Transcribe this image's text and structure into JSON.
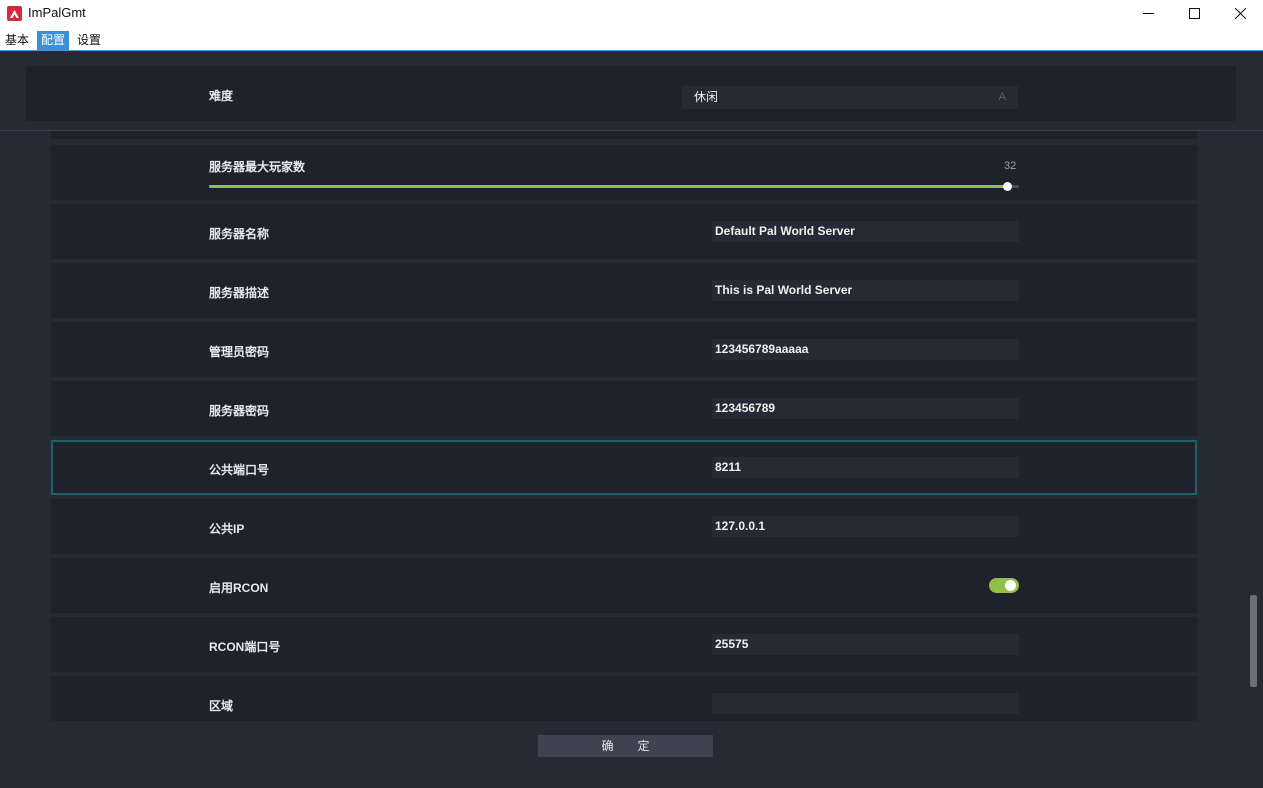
{
  "window": {
    "title": "ImPalGmt",
    "minimize_glyph": "—",
    "maximize_glyph": "☐",
    "close_glyph": "✕"
  },
  "menu": {
    "items": [
      {
        "label": "基本",
        "active": false
      },
      {
        "label": "配置",
        "active": true
      },
      {
        "label": "设置",
        "active": false
      }
    ]
  },
  "settings": {
    "difficulty": {
      "label": "难度",
      "value": "休闲",
      "arrow": "A"
    },
    "max_players": {
      "label": "服务器最大玩家数",
      "value": "32",
      "fraction": 0.985
    },
    "server_name": {
      "label": "服务器名称",
      "value": "Default Pal World Server"
    },
    "server_description": {
      "label": "服务器描述",
      "value": "This is Pal World Server"
    },
    "admin_password": {
      "label": "管理员密码",
      "value": "123456789aaaaa"
    },
    "server_password": {
      "label": "服务器密码",
      "value": "123456789"
    },
    "public_port": {
      "label": "公共端口号",
      "value": "8211"
    },
    "public_ip": {
      "label": "公共IP",
      "value": "127.0.0.1"
    },
    "rcon_enabled": {
      "label": "启用RCON",
      "enabled": true
    },
    "rcon_port": {
      "label": "RCON端口号",
      "value": "25575"
    },
    "region": {
      "label": "区域",
      "value": ""
    }
  },
  "confirm_button": {
    "label": "确　　定"
  },
  "colors": {
    "accent_green": "#8ec04a",
    "menu_active": "#3d8fd4",
    "selected_border": "#1f5f6e",
    "logo_red": "#d7263d"
  }
}
